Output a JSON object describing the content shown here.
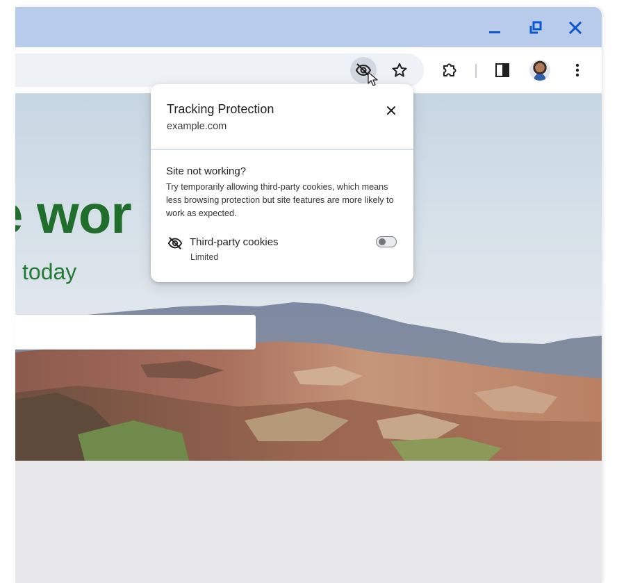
{
  "browser": {
    "window_controls": {
      "minimize_icon": "minimize-icon",
      "restore_icon": "restore-icon",
      "close_icon": "close-icon"
    },
    "toolbar": {
      "tracking_icon": "eye-slash-icon",
      "bookmark_icon": "star-icon",
      "extensions_icon": "puzzle-icon",
      "side_panel_icon": "side-panel-icon",
      "menu_icon": "kebab-menu-icon"
    }
  },
  "page": {
    "heading": "e wor",
    "subheading": "today"
  },
  "popup": {
    "title": "Tracking Protection",
    "site": "example.com",
    "section_title": "Site not working?",
    "section_body": "Try temporarily allowing third-party cookies, which means less browsing protection but site features are more likely to work as expected.",
    "setting": {
      "label": "Third-party cookies",
      "status": "Limited",
      "enabled": false
    }
  },
  "colors": {
    "titlebar": "#b8cbea",
    "accent_blue": "#0b57d0",
    "hero_green": "#1f6e2c"
  }
}
